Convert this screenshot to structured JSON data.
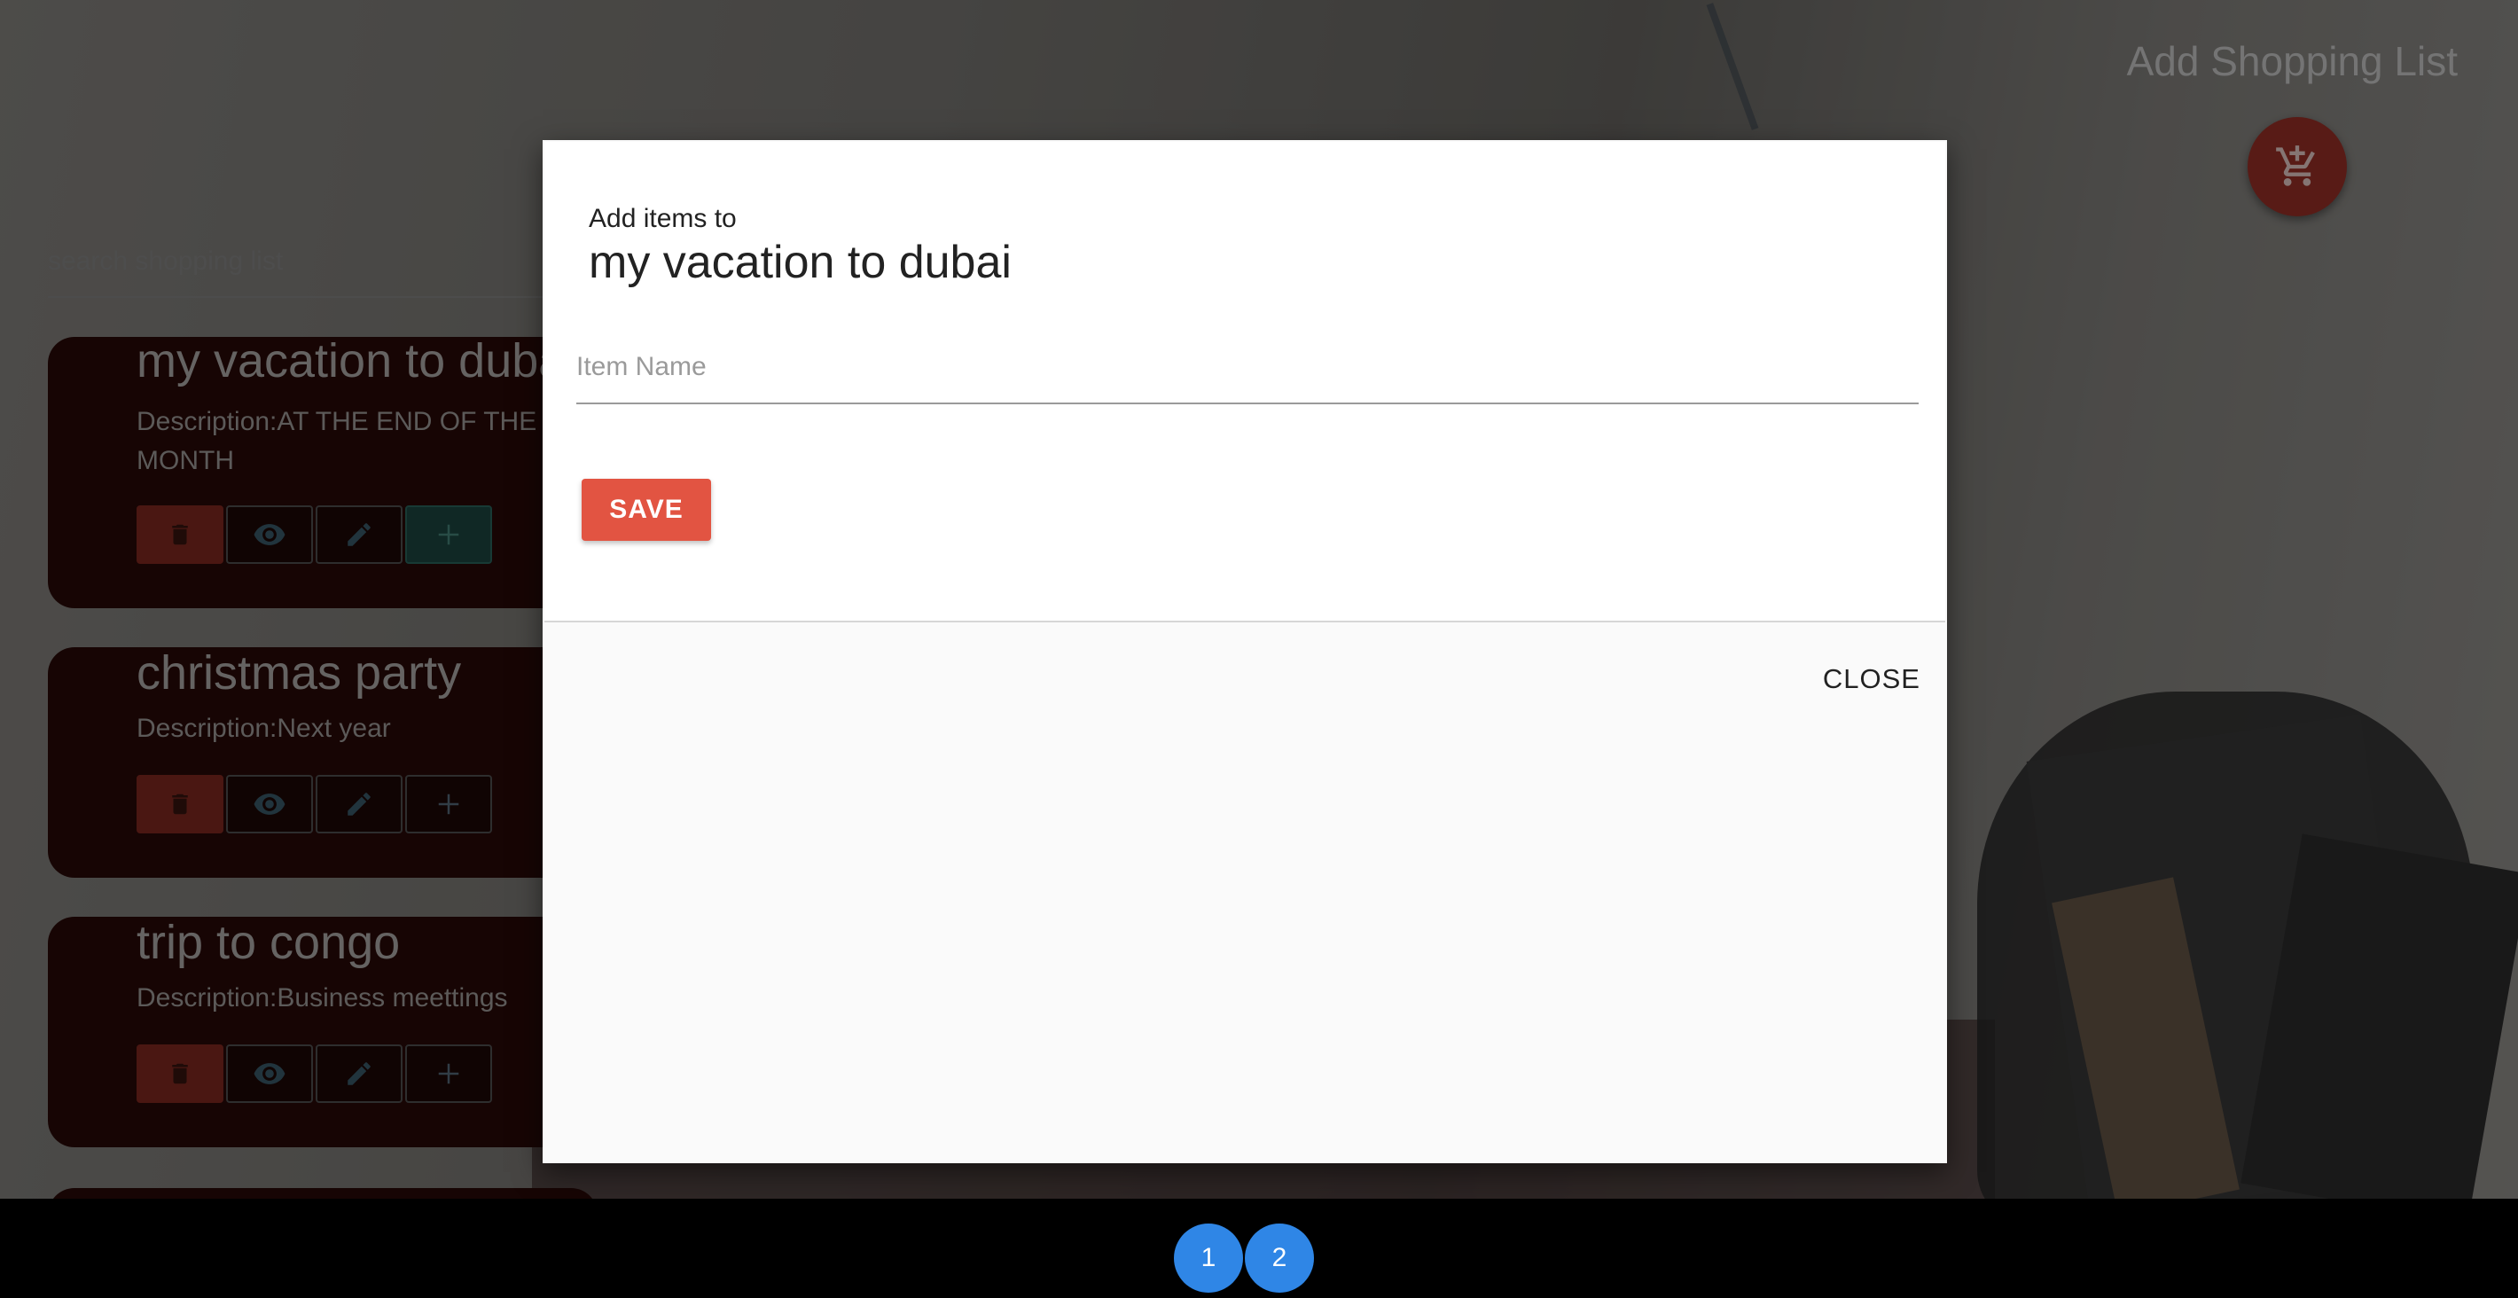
{
  "header": {
    "add_list_title": "Add Shopping List",
    "fab_icon": "add-shopping-cart-icon"
  },
  "search": {
    "placeholder": "search shopping list"
  },
  "lists": [
    {
      "title": "my vacation to dubai",
      "description": "Description:AT THE END OF THE MONTH"
    },
    {
      "title": "christmas party",
      "description": "Description:Next year"
    },
    {
      "title": "trip to congo",
      "description": "Description:Business meettings"
    }
  ],
  "card_actions": [
    "trash-icon",
    "eye-icon",
    "pencil-icon",
    "plus-icon"
  ],
  "modal": {
    "subtitle": "Add items to",
    "title": "my vacation to dubai",
    "input_placeholder": "Item Name",
    "save_label": "SAVE",
    "close_label": "CLOSE"
  },
  "pagination": {
    "pages": [
      "1",
      "2"
    ]
  },
  "colors": {
    "delete": "#872a21",
    "save": "#e25442",
    "fab": "#a03228",
    "page": "#2f86e6"
  }
}
